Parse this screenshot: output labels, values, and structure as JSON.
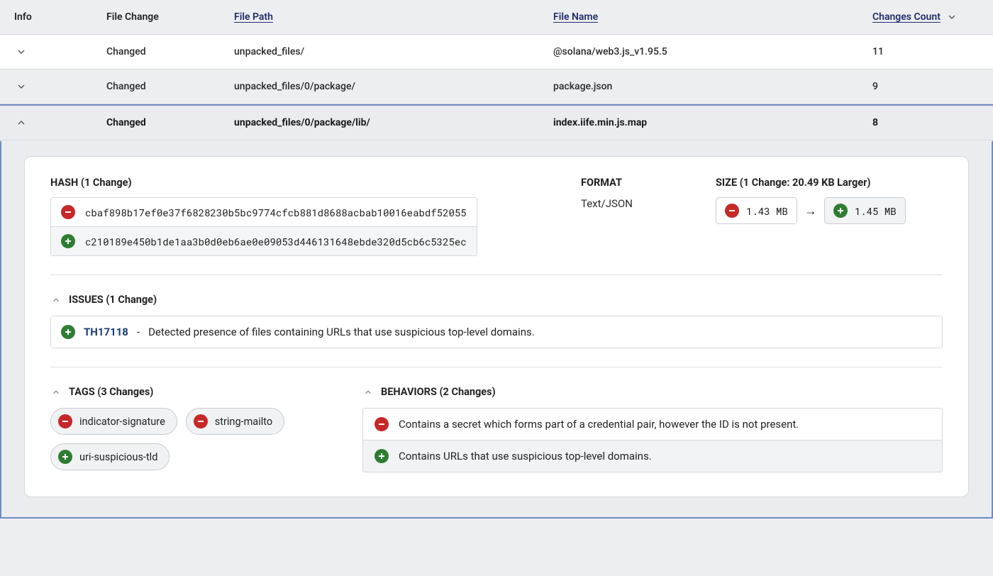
{
  "columns": {
    "info": "Info",
    "file_change": "File Change",
    "file_path": "File Path",
    "file_name": "File Name",
    "changes_count": "Changes Count"
  },
  "rows": [
    {
      "file_change": "Changed",
      "file_path": "unpacked_files/",
      "file_name": "@solana/web3.js_v1.95.5",
      "changes_count": "11",
      "expanded": false
    },
    {
      "file_change": "Changed",
      "file_path": "unpacked_files/0/package/",
      "file_name": "package.json",
      "changes_count": "9",
      "expanded": false
    },
    {
      "file_change": "Changed",
      "file_path": "unpacked_files/0/package/lib/",
      "file_name": "index.iife.min.js.map",
      "changes_count": "8",
      "expanded": true
    }
  ],
  "detail": {
    "hash": {
      "heading": "HASH (1 Change)",
      "removed": "cbaf898b17ef0e37f6828230b5bc9774cfcb881d8688acbab10016eabdf52055",
      "added": "c210189e450b1de1aa3b0d0eb6ae0e09053d446131648ebde320d5cb6c5325ec"
    },
    "format": {
      "heading": "FORMAT",
      "value": "Text/JSON"
    },
    "size": {
      "heading": "SIZE (1 Change: 20.49 KB Larger)",
      "removed": "1.43 MB",
      "added": "1.45 MB"
    },
    "issues": {
      "heading": "ISSUES (1 Change)",
      "items": [
        {
          "kind": "added",
          "id": "TH17118",
          "text": "Detected presence of files containing URLs that use suspicious top-level domains."
        }
      ]
    },
    "tags": {
      "heading": "TAGS (3 Changes)",
      "items": [
        {
          "kind": "removed",
          "label": "indicator-signature"
        },
        {
          "kind": "removed",
          "label": "string-mailto"
        },
        {
          "kind": "added",
          "label": "uri-suspicious-tld"
        }
      ]
    },
    "behaviors": {
      "heading": "BEHAVIORS (2 Changes)",
      "items": [
        {
          "kind": "removed",
          "text": "Contains a secret which forms part of a credential pair, however the ID is not present."
        },
        {
          "kind": "added",
          "text": "Contains URLs that use suspicious top-level domains."
        }
      ]
    }
  }
}
